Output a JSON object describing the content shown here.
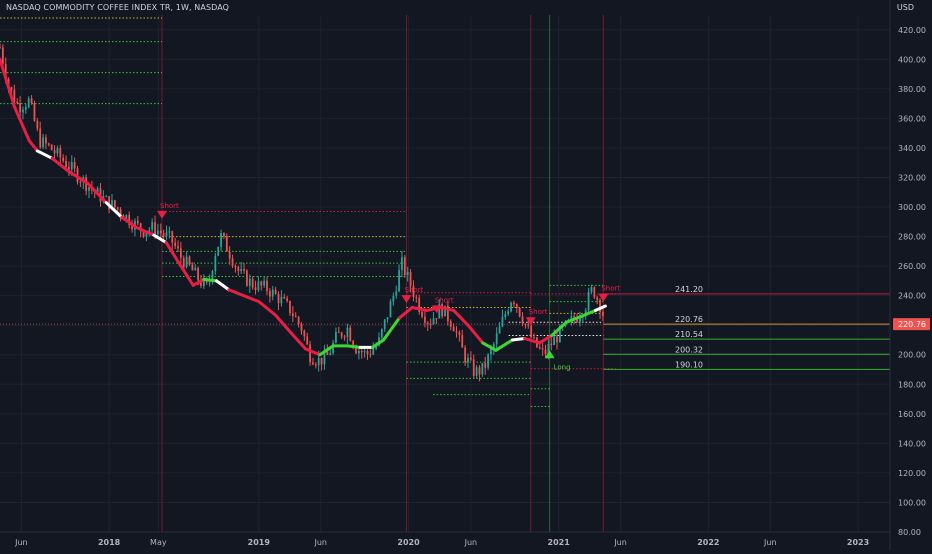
{
  "header": {
    "symbol_title": "NASDAQ COMMODITY COFFEE INDEX TR, 1W, NASDAQ",
    "currency": "USD"
  },
  "colors": {
    "background": "#131722",
    "up": "#26a69a",
    "down": "#ef5350",
    "trend_down": "#e91e45",
    "trend_up": "#3ed633",
    "last_price_bg": "#ef5350"
  },
  "chart_data": {
    "type": "candlestick",
    "yaxis": {
      "min": 80,
      "max": 430,
      "ticks": [
        80,
        100,
        120,
        140,
        160,
        180,
        200,
        220,
        240,
        260,
        280,
        300,
        320,
        340,
        360,
        380,
        400,
        420
      ]
    },
    "xaxis": {
      "range": [
        "2017-04-10",
        "2023-03-15"
      ],
      "ticks": [
        {
          "label": "Jun",
          "date": "2017-06-01",
          "bold": false
        },
        {
          "label": "2018",
          "date": "2018-01-01",
          "bold": true
        },
        {
          "label": "May",
          "date": "2018-05-01",
          "bold": false
        },
        {
          "label": "2019",
          "date": "2019-01-01",
          "bold": true
        },
        {
          "label": "Jun",
          "date": "2019-06-01",
          "bold": false
        },
        {
          "label": "2020",
          "date": "2020-01-01",
          "bold": true
        },
        {
          "label": "Jun",
          "date": "2020-06-01",
          "bold": false
        },
        {
          "label": "2021",
          "date": "2021-01-01",
          "bold": true
        },
        {
          "label": "Jun",
          "date": "2021-06-01",
          "bold": false
        },
        {
          "label": "2022",
          "date": "2022-01-01",
          "bold": true
        },
        {
          "label": "Jun",
          "date": "2022-06-01",
          "bold": false
        },
        {
          "label": "2023",
          "date": "2023-01-01",
          "bold": true
        }
      ]
    },
    "price_path": [
      [
        "2017-04-10",
        408
      ],
      [
        "2017-05-01",
        382
      ],
      [
        "2017-05-25",
        368
      ],
      [
        "2017-06-20",
        372
      ],
      [
        "2017-07-15",
        345
      ],
      [
        "2017-08-10",
        340
      ],
      [
        "2017-09-10",
        332
      ],
      [
        "2017-10-15",
        322
      ],
      [
        "2017-11-20",
        312
      ],
      [
        "2017-12-20",
        305
      ],
      [
        "2018-01-25",
        298
      ],
      [
        "2018-02-25",
        290
      ],
      [
        "2018-03-25",
        284
      ],
      [
        "2018-04-20",
        286
      ],
      [
        "2018-05-10",
        282
      ],
      [
        "2018-06-01",
        278
      ],
      [
        "2018-06-25",
        266
      ],
      [
        "2018-07-20",
        258
      ],
      [
        "2018-08-10",
        250
      ],
      [
        "2018-08-30",
        245
      ],
      [
        "2018-09-15",
        268
      ],
      [
        "2018-10-01",
        280
      ],
      [
        "2018-10-20",
        270
      ],
      [
        "2018-11-15",
        255
      ],
      [
        "2018-12-15",
        248
      ],
      [
        "2019-01-20",
        245
      ],
      [
        "2019-02-20",
        238
      ],
      [
        "2019-03-20",
        230
      ],
      [
        "2019-04-15",
        218
      ],
      [
        "2019-05-05",
        200
      ],
      [
        "2019-05-25",
        196
      ],
      [
        "2019-06-15",
        198
      ],
      [
        "2019-07-10",
        212
      ],
      [
        "2019-08-05",
        218
      ],
      [
        "2019-08-25",
        205
      ],
      [
        "2019-09-20",
        200
      ],
      [
        "2019-10-20",
        208
      ],
      [
        "2019-11-25",
        240
      ],
      [
        "2019-12-15",
        262
      ],
      [
        "2020-01-05",
        248
      ],
      [
        "2020-01-25",
        234
      ],
      [
        "2020-02-20",
        222
      ],
      [
        "2020-03-20",
        232
      ],
      [
        "2020-04-20",
        220
      ],
      [
        "2020-05-15",
        200
      ],
      [
        "2020-06-10",
        188
      ],
      [
        "2020-07-01",
        190
      ],
      [
        "2020-07-25",
        205
      ],
      [
        "2020-08-20",
        225
      ],
      [
        "2020-09-10",
        240
      ],
      [
        "2020-10-05",
        225
      ],
      [
        "2020-11-01",
        208
      ],
      [
        "2020-11-25",
        200
      ],
      [
        "2020-12-20",
        210
      ],
      [
        "2021-01-15",
        218
      ],
      [
        "2021-02-10",
        225
      ],
      [
        "2021-03-05",
        232
      ],
      [
        "2021-03-25",
        245
      ],
      [
        "2021-04-15",
        232
      ],
      [
        "2021-04-25",
        220.76
      ]
    ],
    "trend_line": {
      "points": [
        [
          "2017-04-10",
          400
        ],
        [
          "2017-05-15",
          368
        ],
        [
          "2017-06-20",
          345
        ],
        [
          "2017-07-10",
          338
        ],
        [
          "2017-08-15",
          333
        ],
        [
          "2017-09-25",
          324
        ],
        [
          "2017-11-10",
          316
        ],
        [
          "2017-12-25",
          303
        ],
        [
          "2018-02-01",
          293
        ],
        [
          "2018-03-10",
          286
        ],
        [
          "2018-04-20",
          281
        ],
        [
          "2018-05-20",
          276
        ],
        [
          "2018-06-25",
          260
        ],
        [
          "2018-07-25",
          247
        ],
        [
          "2018-08-20",
          251
        ],
        [
          "2018-09-20",
          250
        ],
        [
          "2018-10-20",
          244
        ],
        [
          "2018-11-25",
          240
        ],
        [
          "2019-01-01",
          236
        ],
        [
          "2019-02-10",
          227
        ],
        [
          "2019-03-20",
          215
        ],
        [
          "2019-04-25",
          204
        ],
        [
          "2019-05-30",
          200
        ],
        [
          "2019-07-01",
          206
        ],
        [
          "2019-08-05",
          206
        ],
        [
          "2019-09-05",
          205
        ],
        [
          "2019-10-05",
          205
        ],
        [
          "2019-11-01",
          210
        ],
        [
          "2019-12-10",
          225
        ],
        [
          "2020-01-10",
          232
        ],
        [
          "2020-02-15",
          230
        ],
        [
          "2020-03-20",
          232
        ],
        [
          "2020-04-20",
          230
        ],
        [
          "2020-05-25",
          220
        ],
        [
          "2020-06-30",
          208
        ],
        [
          "2020-08-01",
          203
        ],
        [
          "2020-09-10",
          210
        ],
        [
          "2020-10-10",
          211
        ],
        [
          "2020-11-15",
          208
        ],
        [
          "2020-12-15",
          213
        ],
        [
          "2021-01-20",
          222
        ],
        [
          "2021-02-25",
          226
        ],
        [
          "2021-04-01",
          230
        ],
        [
          "2021-04-25",
          233
        ]
      ],
      "colors": [
        "#e91e45",
        "#e91e45",
        "#e91e45",
        "#ffffff",
        "#e91e45",
        "#e91e45",
        "#e91e45",
        "#ffffff",
        "#e91e45",
        "#e91e45",
        "#ffffff",
        "#e91e45",
        "#e91e45",
        "#e91e45",
        "#3ed633",
        "#ffffff",
        "#e91e45",
        "#e91e45",
        "#e91e45",
        "#e91e45",
        "#e91e45",
        "#e91e45",
        "#3ed633",
        "#3ed633",
        "#3ed633",
        "#ffffff",
        "#3ed633",
        "#3ed633",
        "#e91e45",
        "#e91e45",
        "#e91e45",
        "#e91e45",
        "#e91e45",
        "#e91e45",
        "#3ed633",
        "#3ed633",
        "#ffffff",
        "#e91e45",
        "#e91e45",
        "#3ed633",
        "#3ed633",
        "#3ed633",
        "#ffffff"
      ]
    },
    "vertical_lines": [
      {
        "date": "2018-05-10",
        "color": "#e91e45"
      },
      {
        "date": "2019-12-27",
        "color": "#e91e45"
      },
      {
        "date": "2020-10-25",
        "color": "#e91e45"
      },
      {
        "date": "2020-12-10",
        "color": "#3ed633"
      },
      {
        "date": "2021-04-20",
        "color": "#e91e45"
      }
    ],
    "signals": [
      {
        "date": "2018-05-10",
        "price": 294,
        "label": "Short",
        "type": "short"
      },
      {
        "date": "2019-12-27",
        "price": 237,
        "label": "Short",
        "type": "short"
      },
      {
        "date": "2020-03-10",
        "price": 230,
        "label": "Short",
        "type": "short"
      },
      {
        "date": "2020-10-25",
        "price": 222,
        "label": "Short",
        "type": "short"
      },
      {
        "date": "2020-12-10",
        "price": 201,
        "label": "Long",
        "type": "long"
      },
      {
        "date": "2021-04-20",
        "price": 238,
        "label": "Short",
        "type": "short"
      }
    ],
    "level_lines": [
      {
        "start": "2018-05-10",
        "end": "2018-05-10",
        "price": 428,
        "color": "#e6c229",
        "left": true
      },
      {
        "start": "2018-05-10",
        "end": "2018-05-10",
        "price": 412,
        "color": "#3ed633",
        "left": true
      },
      {
        "start": "2018-05-10",
        "end": "2018-05-10",
        "price": 391,
        "color": "#3ed633",
        "left": true
      },
      {
        "start": "2018-05-10",
        "end": "2018-05-10",
        "price": 370,
        "color": "#3ed633",
        "left": true
      },
      {
        "start": "2018-05-10",
        "end": "2019-12-27",
        "price": 297,
        "color": "#e91e45"
      },
      {
        "start": "2018-05-10",
        "end": "2019-12-27",
        "price": 280,
        "color": "#e6c229"
      },
      {
        "start": "2018-05-10",
        "end": "2019-12-27",
        "price": 270,
        "color": "#3ed633"
      },
      {
        "start": "2018-05-10",
        "end": "2019-12-27",
        "price": 262,
        "color": "#3ed633"
      },
      {
        "start": "2018-05-10",
        "end": "2019-12-27",
        "price": 253,
        "color": "#3ed633"
      },
      {
        "start": "2019-12-27",
        "end": "2020-10-25",
        "price": 242,
        "color": "#e91e45"
      },
      {
        "start": "2019-12-27",
        "end": "2020-10-25",
        "price": 232,
        "color": "#e6c229"
      },
      {
        "start": "2019-12-27",
        "end": "2020-10-25",
        "price": 195,
        "color": "#3ed633"
      },
      {
        "start": "2019-12-27",
        "end": "2020-10-25",
        "price": 184,
        "color": "#3ed633"
      },
      {
        "start": "2020-03-01",
        "end": "2020-10-25",
        "price": 173,
        "color": "#3ed633"
      },
      {
        "start": "2020-10-25",
        "end": "2020-12-10",
        "price": 177,
        "color": "#3ed633"
      },
      {
        "start": "2020-10-25",
        "end": "2020-12-10",
        "price": 165,
        "color": "#3ed633"
      },
      {
        "start": "2020-12-10",
        "end": "2021-04-20",
        "price": 247,
        "color": "#3ed633"
      },
      {
        "start": "2020-12-10",
        "end": "2021-04-20",
        "price": 236,
        "color": "#3ed633"
      },
      {
        "start": "2020-12-10",
        "end": "2021-04-20",
        "price": 228,
        "color": "#e6c229"
      },
      {
        "start": "2020-10-25",
        "end": "2021-05-20",
        "price": 241.2,
        "color": "#e91e45"
      },
      {
        "start": "2020-09-01",
        "end": "2021-04-20",
        "price": 222,
        "color": "#ffffff"
      },
      {
        "start": "2020-09-01",
        "end": "2021-04-20",
        "price": 213,
        "color": "#ffffff"
      },
      {
        "start": "2020-10-25",
        "end": "2021-05-20",
        "price": 190.5,
        "color": "#e91e45"
      }
    ],
    "price_levels": [
      {
        "price": 241.2,
        "label": "241.20",
        "color": "#e91e45"
      },
      {
        "price": 220.76,
        "label": "220.76",
        "color": "#e6c229"
      },
      {
        "price": 210.54,
        "label": "210.54",
        "color": "#3ed633"
      },
      {
        "price": 200.32,
        "label": "200.32",
        "color": "#3ed633"
      },
      {
        "price": 190.1,
        "label": "190.10",
        "color": "#3ed633"
      }
    ],
    "last_price": {
      "price": 220.76,
      "label": "220.76"
    }
  }
}
